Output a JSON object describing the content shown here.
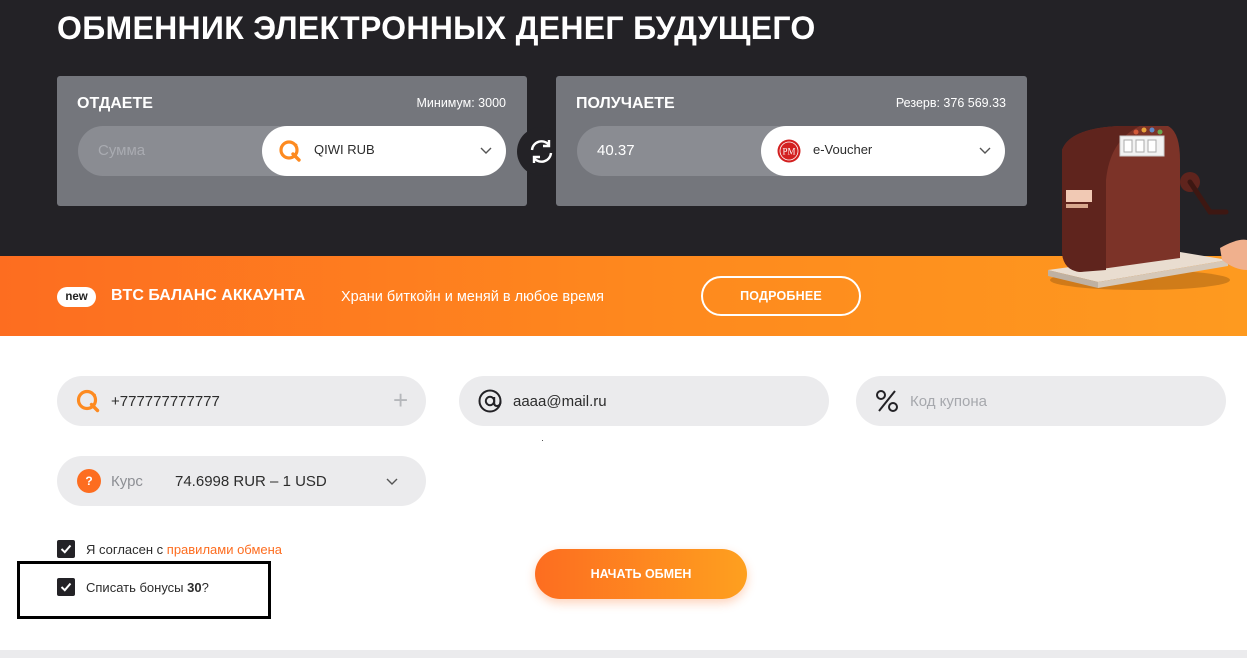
{
  "hero": {
    "title": "ОБМЕННИК ЭЛЕКТРОННЫХ ДЕНЕГ БУДУЩЕГО"
  },
  "give": {
    "label": "ОТДАЕТЕ",
    "meta": "Минимум: 3000",
    "amount_placeholder": "Сумма",
    "currency": "QIWI RUB",
    "currency_icon": "qiwi-icon"
  },
  "get": {
    "label": "ПОЛУЧАЕТЕ",
    "meta": "Резерв: 376 569.33",
    "amount": "40.37",
    "currency": "e-Voucher",
    "currency_icon": "perfect-money-icon",
    "currency_icon_text": "PM"
  },
  "banner": {
    "badge": "new",
    "title": "BTC БАЛАНС АККАУНТА",
    "text": "Храни биткойн и меняй в любое время",
    "button": "ПОДРОБНЕЕ"
  },
  "form": {
    "phone": "+777777777777",
    "email": "aaaa@mail.ru",
    "coupon_placeholder": "Код купона",
    "rate_icon": "?",
    "rate_label": "Курс",
    "rate_value": "74.6998 RUR – 1 USD"
  },
  "agree": {
    "text": "Я согласен с ",
    "link": "правилами обмена",
    "checked": true
  },
  "bonus": {
    "text": "Списать бонусы ",
    "amount": "30",
    "suffix": "?",
    "checked": true
  },
  "actions": {
    "start": "НАЧАТЬ ОБМЕН"
  },
  "colors": {
    "accent": "#fd6d20",
    "dark": "#232226",
    "panel": "#74767c",
    "field": "#ebebed"
  }
}
